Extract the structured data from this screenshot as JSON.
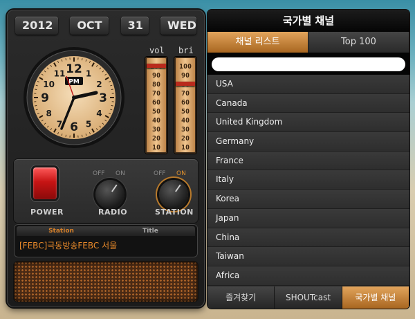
{
  "date": {
    "year": "2012",
    "month": "OCT",
    "day": "31",
    "weekday": "WED"
  },
  "clock": {
    "ampm": "PM",
    "numbers": [
      "12",
      "1",
      "2",
      "3",
      "4",
      "5",
      "6",
      "7",
      "8",
      "9",
      "10",
      "11"
    ]
  },
  "meters": {
    "vol_label": "vol",
    "bri_label": "bri",
    "vol_scale": [
      "100",
      "90",
      "80",
      "70",
      "60",
      "50",
      "40",
      "30",
      "20",
      "10"
    ],
    "bri_scale": [
      "100",
      "90",
      "80",
      "70",
      "60",
      "50",
      "40",
      "30",
      "20",
      "10"
    ],
    "vol_level": 100,
    "bri_level": 80
  },
  "controls": {
    "power_label": "POWER",
    "radio_label": "RADIO",
    "station_label": "STATION",
    "off_label": "OFF",
    "on_label": "ON"
  },
  "info": {
    "station_tab": "Station",
    "title_tab": "Title",
    "text": "[FEBC]극동방송FEBC 서울"
  },
  "panel": {
    "title": "국가별 채널",
    "tabs": [
      "채널 리스트",
      "Top 100"
    ],
    "search_placeholder": "",
    "countries": [
      "USA",
      "Canada",
      "United Kingdom",
      "Germany",
      "France",
      "Italy",
      "Korea",
      "Japan",
      "China",
      "Taiwan",
      "Africa"
    ],
    "bottom_tabs": [
      "즐겨찾기",
      "SHOUTcast",
      "국가별 채널"
    ]
  },
  "colors": {
    "accent": "#d7812a",
    "power": "#d01818"
  }
}
